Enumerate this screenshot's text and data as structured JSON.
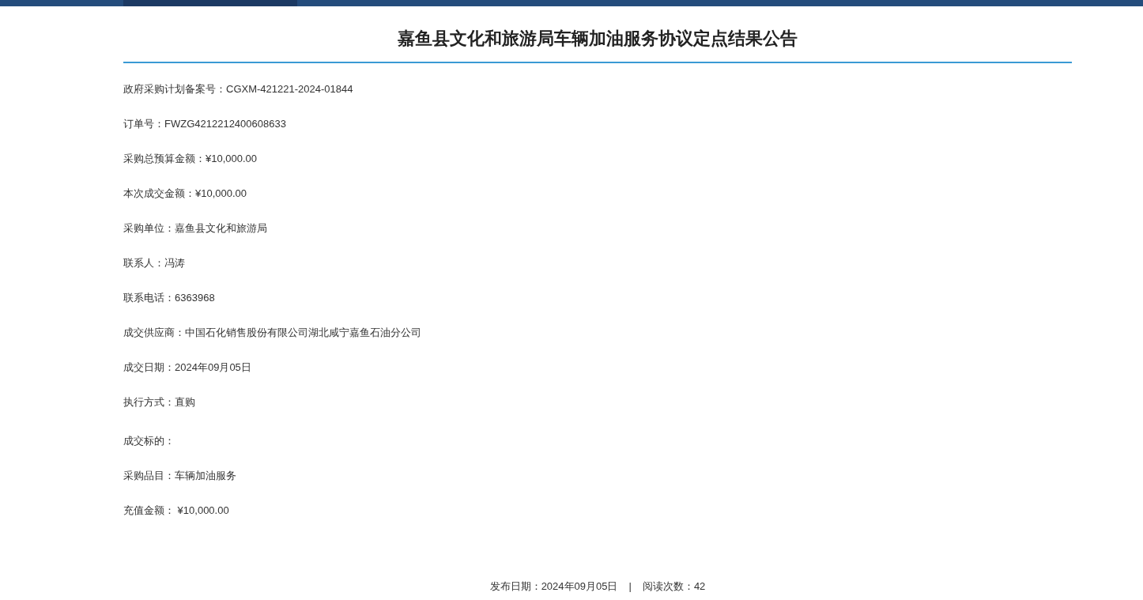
{
  "title": "嘉鱼县文化和旅游局车辆加油服务协议定点结果公告",
  "fields": [
    {
      "kind": "line",
      "text": "政府采购计划备案号：CGXM-421221-2024-01844"
    },
    {
      "kind": "line",
      "text": "订单号：FWZG4212212400608633"
    },
    {
      "kind": "line",
      "text": "采购总预算金额：¥10,000.00"
    },
    {
      "kind": "line",
      "text": "本次成交金额：¥10,000.00"
    },
    {
      "kind": "line",
      "text": "采购单位：嘉鱼县文化和旅游局"
    },
    {
      "kind": "line",
      "text": "联系人：冯涛"
    },
    {
      "kind": "line",
      "text": "联系电话：6363968"
    },
    {
      "kind": "line",
      "text": "成交供应商：中国石化销售股份有限公司湖北咸宁嘉鱼石油分公司"
    },
    {
      "kind": "line",
      "text": "成交日期：2024年09月05日"
    },
    {
      "kind": "line",
      "text": "执行方式：直购"
    },
    {
      "kind": "section",
      "text": "成交标的："
    },
    {
      "kind": "line",
      "text": "采购品目：车辆加油服务"
    },
    {
      "kind": "line",
      "text": "充值金额： ¥10,000.00"
    }
  ],
  "footer": {
    "publish_date": "发布日期：2024年09月05日",
    "separator": "|",
    "read_count": "阅读次数：42"
  }
}
